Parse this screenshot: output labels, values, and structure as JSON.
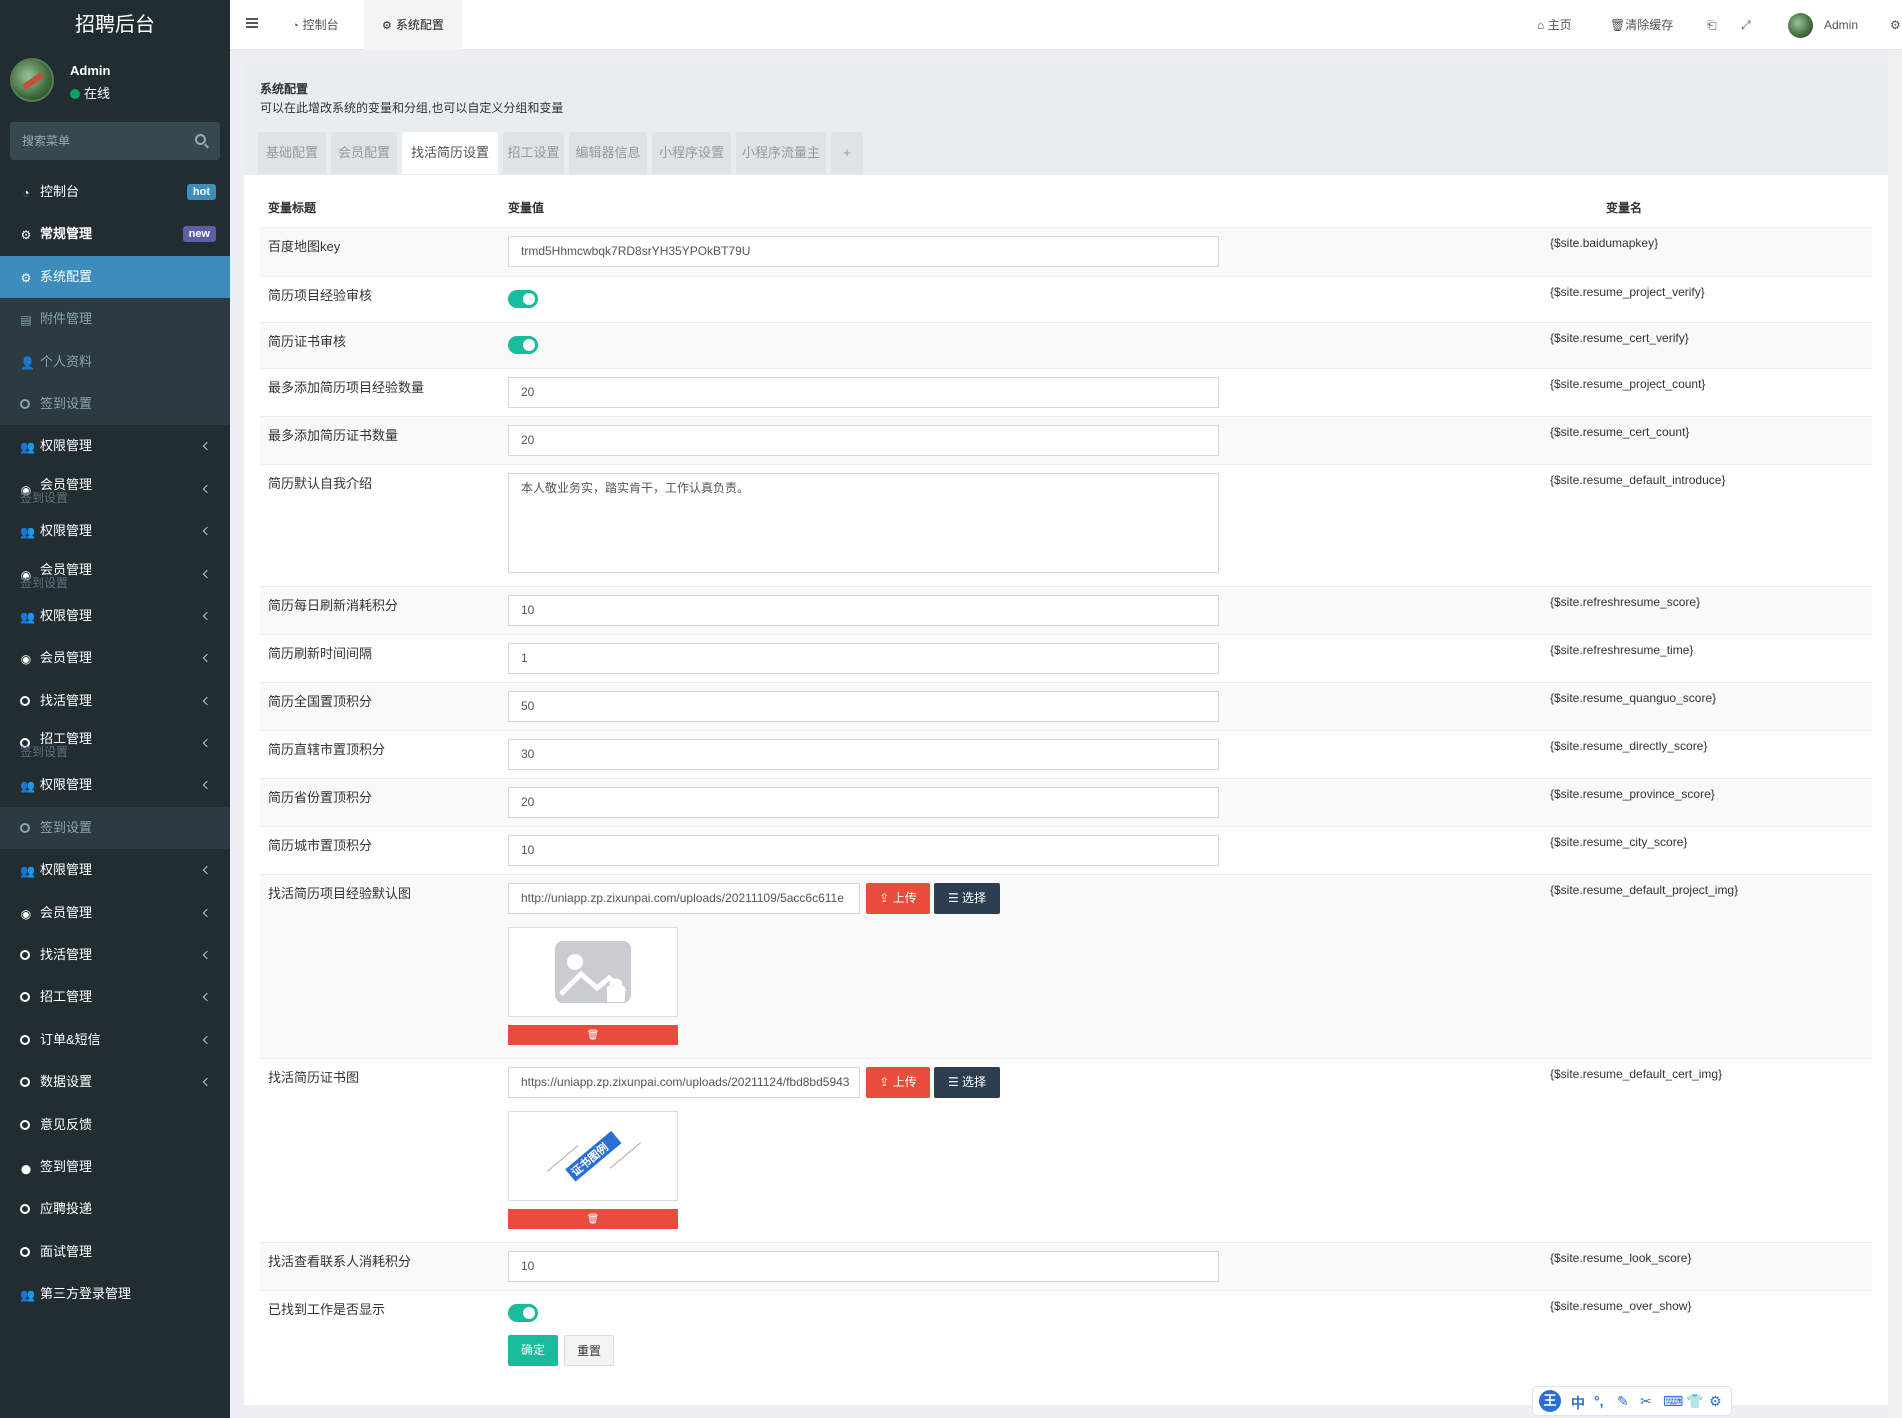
{
  "app": {
    "brand": "招聘后台"
  },
  "user": {
    "name": "Admin",
    "status": "在线"
  },
  "search": {
    "placeholder": "搜索菜单"
  },
  "menu": [
    {
      "label": "控制台",
      "icon": "dashboard-icon",
      "badge": "hot",
      "state": "normal"
    },
    {
      "label": "常规管理",
      "icon": "cogs-icon",
      "badge": "new",
      "state": "bold"
    },
    {
      "label": "系统配置",
      "icon": "gear-icon",
      "state": "active"
    },
    {
      "label": "附件管理",
      "icon": "image-icon",
      "state": "sub"
    },
    {
      "label": "个人资料",
      "icon": "user-icon",
      "state": "sub"
    },
    {
      "label": "签到设置",
      "icon": "circle-icon",
      "state": "sub"
    },
    {
      "label": "权限管理",
      "icon": "group-icon",
      "arrow": true
    },
    {
      "label": "会员管理",
      "icon": "user-circle-icon",
      "arrow": true,
      "ghost": "签到设置"
    },
    {
      "label": "权限管理",
      "icon": "group-icon",
      "arrow": true
    },
    {
      "label": "会员管理",
      "icon": "user-circle-icon",
      "arrow": true,
      "ghost": "签到设置"
    },
    {
      "label": "权限管理",
      "icon": "group-icon",
      "arrow": true
    },
    {
      "label": "会员管理",
      "icon": "user-circle-icon",
      "arrow": true
    },
    {
      "label": "找活管理",
      "icon": "circle-icon",
      "arrow": true
    },
    {
      "label": "招工管理",
      "icon": "circle-icon",
      "arrow": true,
      "ghost": "签到设置"
    },
    {
      "label": "权限管理",
      "icon": "group-icon",
      "arrow": true
    },
    {
      "label": "签到设置",
      "icon": "circle-icon",
      "state": "sub"
    },
    {
      "label": "权限管理",
      "icon": "group-icon",
      "arrow": true
    },
    {
      "label": "会员管理",
      "icon": "user-circle-icon",
      "arrow": true
    },
    {
      "label": "找活管理",
      "icon": "circle-icon",
      "arrow": true
    },
    {
      "label": "招工管理",
      "icon": "circle-icon",
      "arrow": true
    },
    {
      "label": "订单&短信",
      "icon": "circle-icon",
      "arrow": true
    },
    {
      "label": "数据设置",
      "icon": "circle-icon",
      "arrow": true
    },
    {
      "label": "意见反馈",
      "icon": "circle-icon"
    },
    {
      "label": "签到管理",
      "icon": "map-marker-icon"
    },
    {
      "label": "应聘投递",
      "icon": "circle-icon"
    },
    {
      "label": "面试管理",
      "icon": "circle-icon"
    },
    {
      "label": "第三方登录管理",
      "icon": "group-icon"
    }
  ],
  "topbar": {
    "tabs": [
      {
        "label": "控制台",
        "icon": "dashboard-icon"
      },
      {
        "label": "系统配置",
        "icon": "gear-icon",
        "active": true
      }
    ],
    "home_label": "主页",
    "clear_cache_label": "清除缓存",
    "admin_label": "Admin"
  },
  "panel": {
    "title": "系统配置",
    "desc": "可以在此增改系统的变量和分组,也可以自定义分组和变量",
    "tabs": [
      "基础配置",
      "会员配置",
      "找活简历设置",
      "招工设置",
      "编辑器信息",
      "小程序设置",
      "小程序流量主",
      "+"
    ],
    "active_tab_index": 2
  },
  "table": {
    "headers": {
      "title": "变量标题",
      "value": "变量值",
      "name": "变量名"
    },
    "rows": [
      {
        "label": "百度地图key",
        "type": "input",
        "value": "trmd5Hhmcwbqk7RD8srYH35YPOkBT79U",
        "var": "{$site.baidumapkey}"
      },
      {
        "label": "简历项目经验审核",
        "type": "switch",
        "on": true,
        "var": "{$site.resume_project_verify}"
      },
      {
        "label": "简历证书审核",
        "type": "switch",
        "on": true,
        "var": "{$site.resume_cert_verify}"
      },
      {
        "label": "最多添加简历项目经验数量",
        "type": "input",
        "value": "20",
        "var": "{$site.resume_project_count}"
      },
      {
        "label": "最多添加简历证书数量",
        "type": "input",
        "value": "20",
        "var": "{$site.resume_cert_count}"
      },
      {
        "label": "简历默认自我介绍",
        "type": "textarea",
        "value": "本人敬业务实，踏实肯干，工作认真负责。",
        "var": "{$site.resume_default_introduce}"
      },
      {
        "label": "简历每日刷新消耗积分",
        "type": "input",
        "value": "10",
        "var": "{$site.refreshresume_score}"
      },
      {
        "label": "简历刷新时间间隔",
        "type": "input",
        "value": "1",
        "var": "{$site.refreshresume_time}"
      },
      {
        "label": "简历全国置顶积分",
        "type": "input",
        "value": "50",
        "var": "{$site.resume_quanguo_score}"
      },
      {
        "label": "简历直辖市置顶积分",
        "type": "input",
        "value": "30",
        "var": "{$site.resume_directly_score}"
      },
      {
        "label": "简历省份置顶积分",
        "type": "input",
        "value": "20",
        "var": "{$site.resume_province_score}"
      },
      {
        "label": "简历城市置顶积分",
        "type": "input",
        "value": "10",
        "var": "{$site.resume_city_score}"
      },
      {
        "label": "找活简历项目经验默认图",
        "type": "image",
        "value": "http://uniapp.zp.zixunpai.com/uploads/20211109/5acc6c611e",
        "var": "{$site.resume_default_project_img}"
      },
      {
        "label": "找活简历证书图",
        "type": "image",
        "value": "https://uniapp.zp.zixunpai.com/uploads/20211124/fbd8bd5943",
        "var": "{$site.resume_default_cert_img}"
      },
      {
        "label": "找活查看联系人消耗积分",
        "type": "input",
        "value": "10",
        "var": "{$site.resume_look_score}"
      },
      {
        "label": "已找到工作是否显示",
        "type": "switch",
        "on": true,
        "var": "{$site.resume_over_show}"
      }
    ],
    "upload_label": "上传",
    "choose_label": "选择",
    "cert_image_text": "证书图例"
  },
  "actions": {
    "confirm": "确定",
    "reset": "重置"
  },
  "ime_toolbar": {
    "items": [
      "中",
      "°,",
      "✎",
      "✂",
      "⌨",
      "👕",
      "⚙"
    ]
  },
  "colors": {
    "sidebar_bg": "#222d32",
    "active_blue": "#3c8dbc",
    "success": "#18bc9c",
    "danger": "#e74c3c",
    "dark_btn": "#2c3e50"
  }
}
